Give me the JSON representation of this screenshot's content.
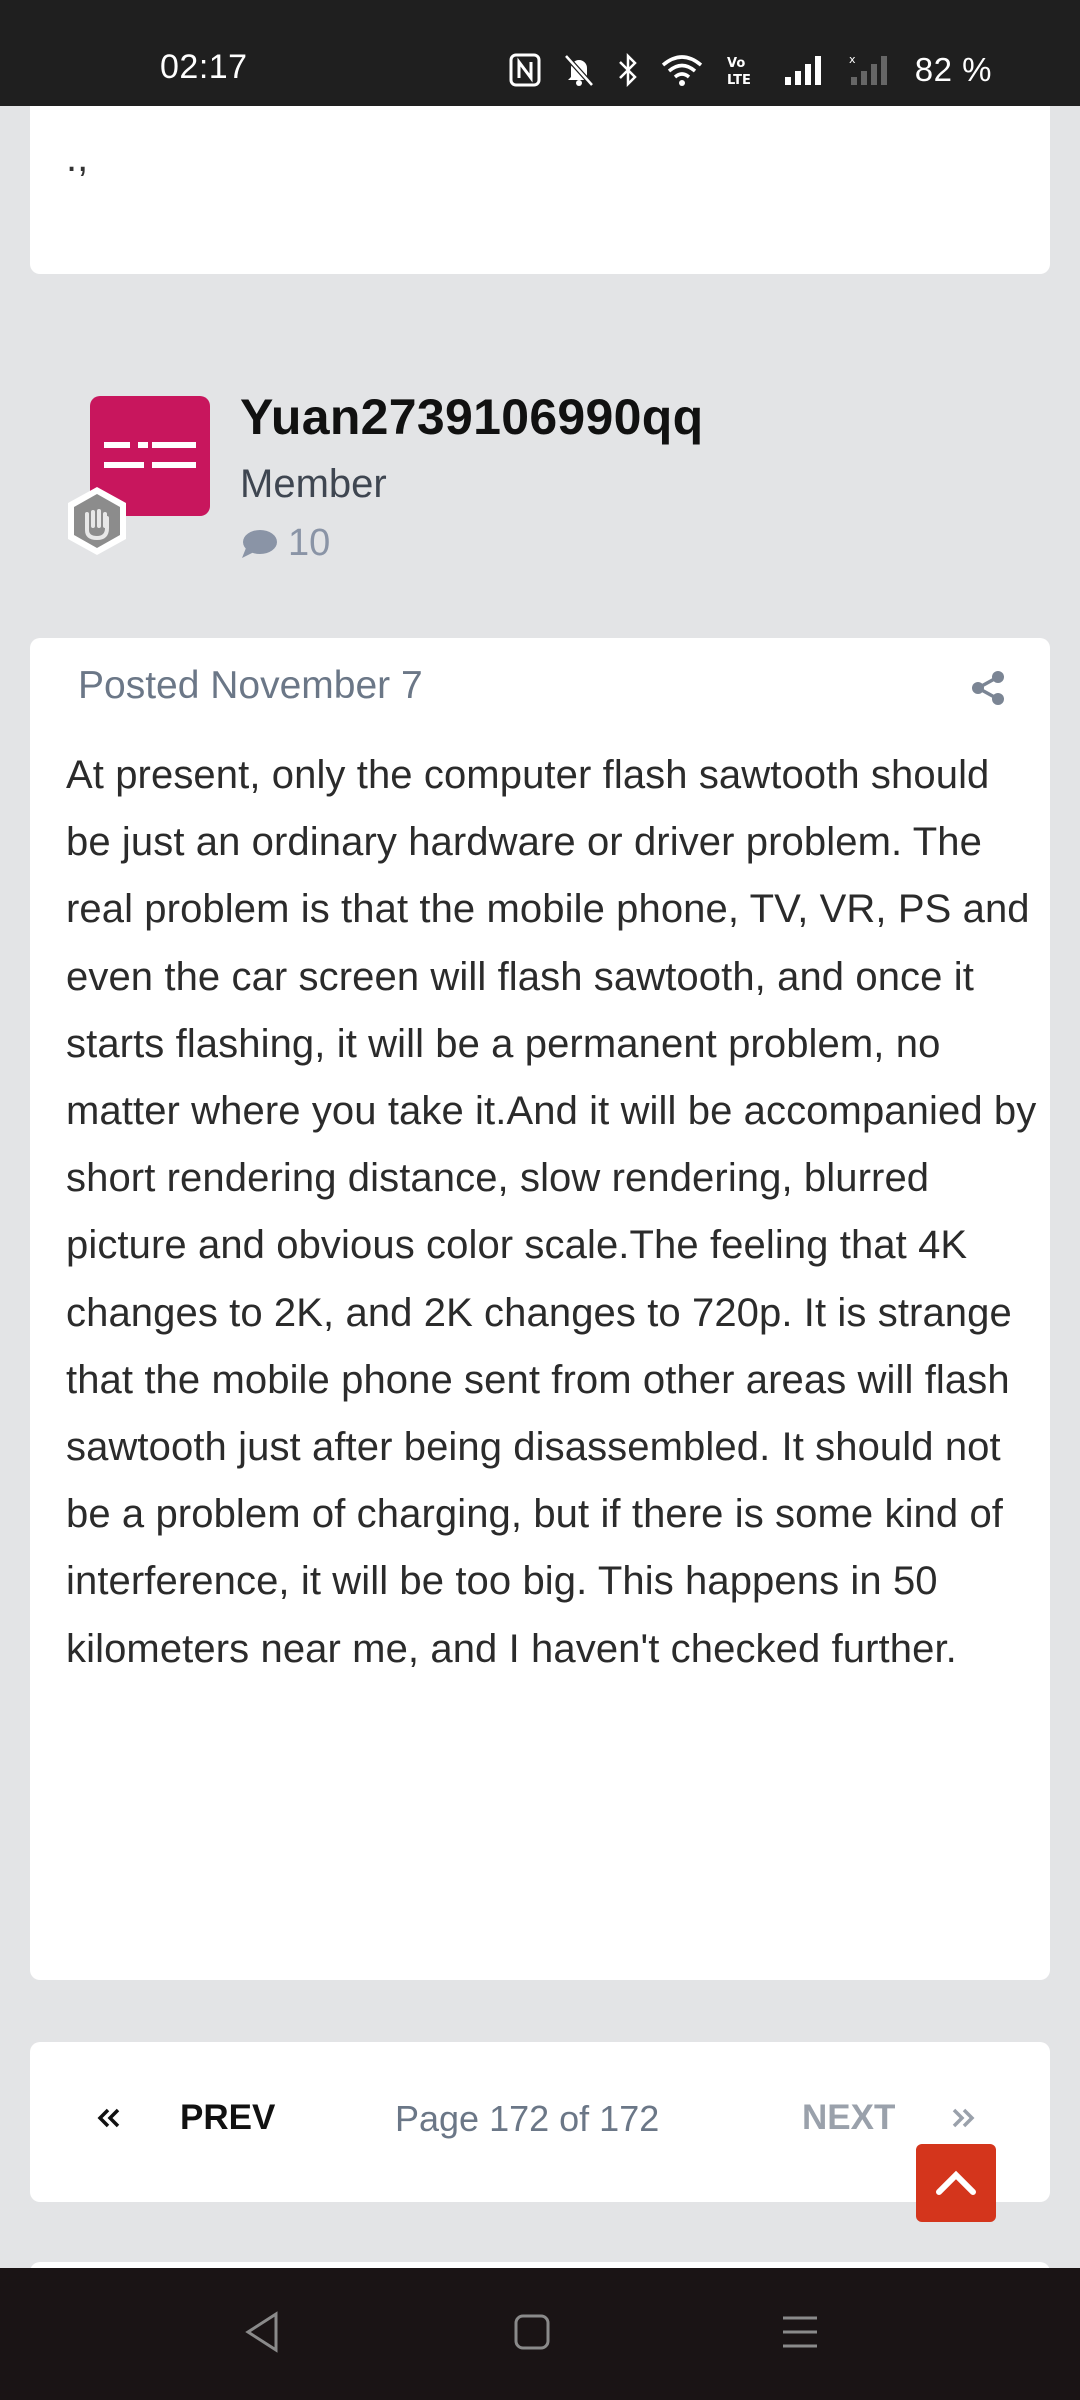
{
  "status_bar": {
    "time": "02:17",
    "battery": "82 %",
    "icons": [
      "nfc-icon",
      "mute-icon",
      "bluetooth-icon",
      "wifi-icon",
      "volte-icon",
      "signal-icon",
      "signal-no-sim-icon"
    ]
  },
  "previous_post": {
    "text": ".,"
  },
  "author": {
    "name": "Yuan2739106990qq",
    "role": "Member",
    "post_count": "10",
    "avatar_color": "#c8165d"
  },
  "post": {
    "meta": "Posted November 7",
    "body": "At present, only the computer flash sawtooth should be just an ordinary hardware or driver problem. The real problem is that the mobile phone, TV, VR, PS and even the car screen will flash sawtooth, and once it starts flashing, it will be a permanent problem, no matter where you take it.And it will be accompanied by short rendering distance, slow rendering, blurred picture and obvious color scale.The feeling that 4K changes to 2K, and 2K changes to 720p. It is strange that the mobile phone sent from other areas will flash sawtooth just after being disassembled. It should not be a problem of charging, but if there is some kind of interference, it will be too big. This happens in 50 kilometers near me, and I haven't checked further."
  },
  "pagination": {
    "prev_label": "PREV",
    "page_label": "Page 172 of 172",
    "next_label": "NEXT"
  },
  "colors": {
    "accent": "#d4351c",
    "muted": "#6b7787"
  }
}
